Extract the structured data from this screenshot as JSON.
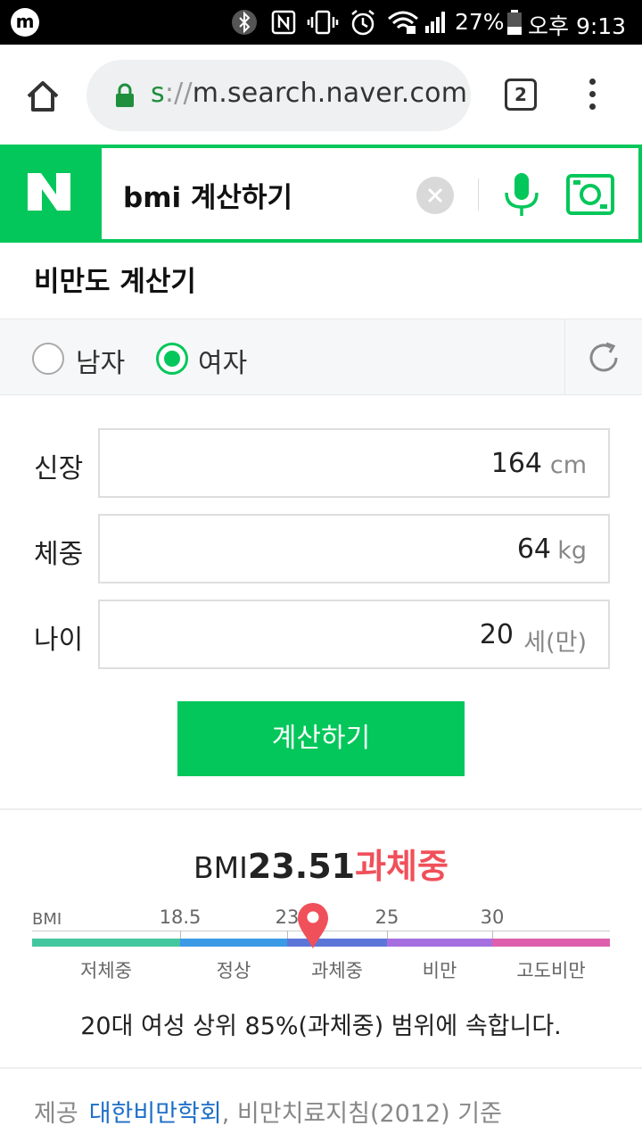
{
  "status_bar": {
    "app_badge": "m",
    "battery": "27%",
    "time": "오후 9:13",
    "icons": [
      "bluetooth-icon",
      "nfc-icon",
      "vibrate-icon",
      "alarm-icon",
      "wifi-icon",
      "signal-icon",
      "battery-icon"
    ]
  },
  "browser": {
    "url_scheme": "s",
    "url_sep": "://",
    "url_host": "m.search.naver.com",
    "tab_count": "2"
  },
  "search": {
    "logo": "N",
    "query": "bmi 계산하기",
    "brand_color": "#03c75a"
  },
  "calculator": {
    "title": "비만도 계산기",
    "gender_options": [
      "남자",
      "여자"
    ],
    "selected_gender": "여자",
    "fields": {
      "height": {
        "label": "신장",
        "value": "164",
        "unit": "cm"
      },
      "weight": {
        "label": "체중",
        "value": "64",
        "unit": "kg"
      },
      "age": {
        "label": "나이",
        "value": "20",
        "unit": "세(만)"
      }
    },
    "submit_label": "계산하기"
  },
  "result": {
    "bmi_label": "BMI",
    "bmi_value": "23.51",
    "classification": "과체중",
    "classification_color": "#f0505a",
    "scale_label": "BMI",
    "thresholds": [
      "18.5",
      "23",
      "25",
      "30"
    ],
    "categories": [
      "저체중",
      "정상",
      "과체중",
      "비만",
      "고도비만"
    ],
    "category_colors": [
      "#44c79f",
      "#3a9ae6",
      "#5b76d8",
      "#a56fe0",
      "#dd5fae"
    ],
    "marker_value": 23.51,
    "summary": "20대 여성 상위 85%(과체중) 범위에 속합니다."
  },
  "footer": {
    "source_prefix": "제공",
    "source_link": "대한비만학회",
    "source_suffix": ", 비만치료지침(2012) 기준"
  }
}
